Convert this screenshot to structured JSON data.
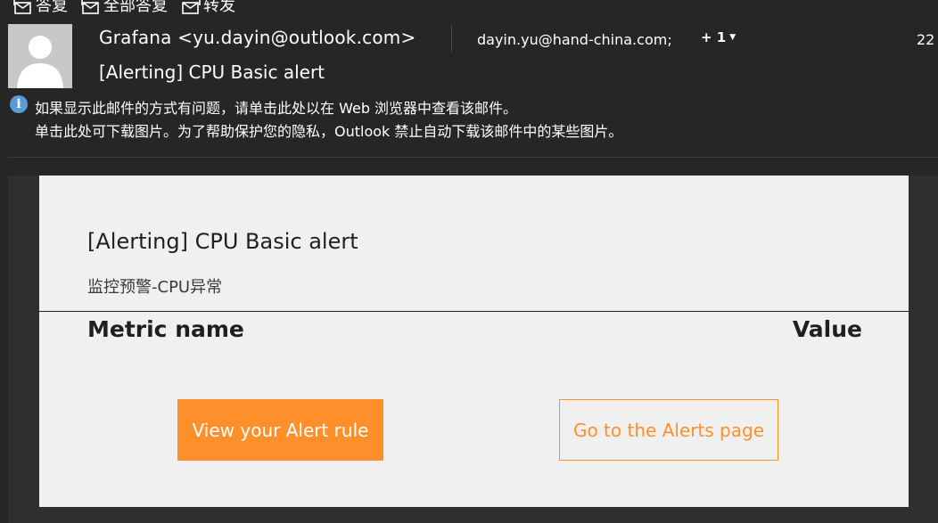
{
  "toolbar": {
    "reply_label": "答复",
    "reply_all_label": "全部答复",
    "forward_label": "转发"
  },
  "header": {
    "sender": "Grafana <yu.dayin@outlook.com>",
    "subject": "[Alerting] CPU Basic alert",
    "recipient": "dayin.yu@hand-china.com;",
    "more_recipients": "+ 1",
    "time": "22"
  },
  "infobar": {
    "line1": "如果显示此邮件的方式有问题，请单击此处以在 Web 浏览器中查看该邮件。",
    "line2": "单击此处可下载图片。为了帮助保护您的隐私，Outlook 禁止自动下载该邮件中的某些图片。"
  },
  "message": {
    "title": "[Alerting] CPU Basic alert",
    "subtitle": "监控预警-CPU异常",
    "column_metric": "Metric name",
    "column_value": "Value",
    "view_rule_button": "View your Alert rule",
    "alerts_page_button": "Go to the Alerts page"
  },
  "colors": {
    "window_bg": "#262626",
    "card_bg": "#f0f0f0",
    "accent_orange": "#ff8f2a",
    "info_blue": "#5b9bd5"
  },
  "icons": {
    "reply": "reply-icon",
    "reply_all": "reply-all-icon",
    "forward": "forward-icon",
    "avatar": "default-avatar-icon",
    "info": "info-icon"
  }
}
